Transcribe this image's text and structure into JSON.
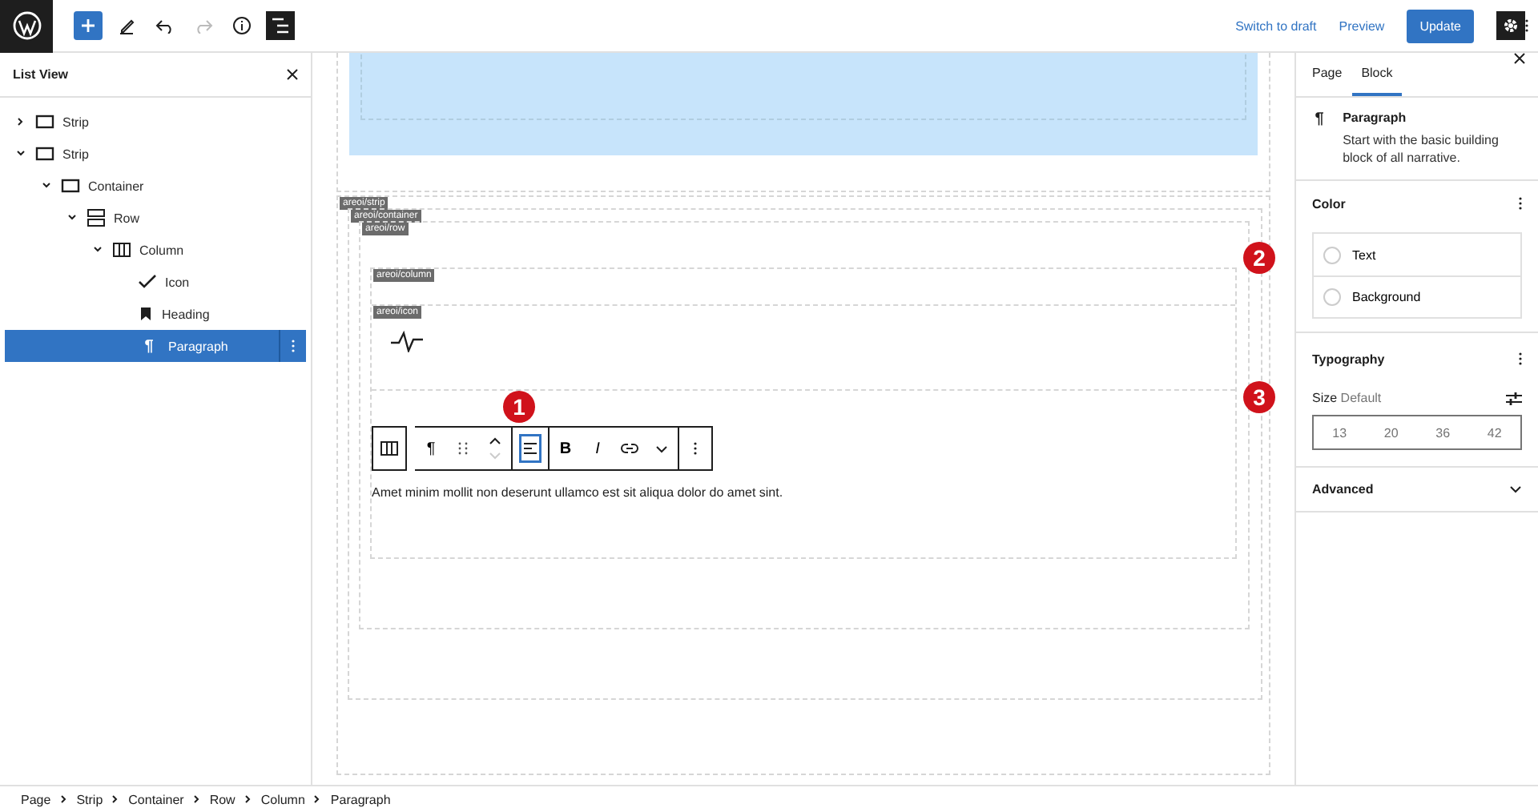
{
  "topbar": {
    "tools": [
      {
        "kind": "add",
        "selected": true
      },
      {
        "kind": "pen",
        "selected": false
      },
      {
        "kind": "undo",
        "selected": false
      },
      {
        "kind": "redo",
        "selected": false
      },
      {
        "kind": "info",
        "selected": false
      },
      {
        "kind": "listview",
        "selected": true
      }
    ],
    "actions": [
      {
        "kind": "link",
        "label": "Switch to draft"
      },
      {
        "kind": "link",
        "label": "Preview"
      },
      {
        "kind": "primary",
        "label": "Update"
      }
    ]
  },
  "list_view": {
    "title": "List View",
    "items": [
      {
        "label": "Strip",
        "kind": "rect",
        "expanded": false,
        "selected": false
      },
      {
        "label": "Strip",
        "kind": "rect",
        "expanded": true,
        "selected": false,
        "children": [
          {
            "label": "Container",
            "kind": "rect",
            "expanded": true,
            "selected": false,
            "children": [
              {
                "label": "Row",
                "kind": "row",
                "expanded": true,
                "selected": false,
                "children": [
                  {
                    "label": "Column",
                    "kind": "column",
                    "expanded": true,
                    "selected": false,
                    "children": [
                      {
                        "label": "Icon",
                        "kind": "check",
                        "selected": false
                      },
                      {
                        "label": "Heading",
                        "kind": "bookmark",
                        "selected": false
                      },
                      {
                        "label": "Paragraph",
                        "kind": "pilcrow",
                        "glyph": "¶",
                        "selected": true
                      }
                    ]
                  }
                ]
              }
            ]
          }
        ]
      }
    ]
  },
  "canvas": {
    "labels": [
      "areoi/strip",
      "areoi/container",
      "areoi/row",
      "areoi/column",
      "areoi/icon"
    ],
    "toolbar": [
      [
        {
          "kind": "columns",
          "selected": false
        }
      ],
      [
        {
          "kind": "text",
          "label": "¶",
          "selected": false
        },
        {
          "kind": "drag",
          "selected": false
        },
        {
          "kind": "movers",
          "selected": false
        }
      ],
      [
        {
          "kind": "align",
          "selected": true
        }
      ],
      [
        {
          "kind": "bold",
          "label": "B",
          "selected": false
        },
        {
          "kind": "italic",
          "label": "I",
          "selected": false
        },
        {
          "kind": "link",
          "selected": false
        },
        {
          "kind": "chevron",
          "selected": false
        }
      ],
      [
        {
          "kind": "more",
          "selected": false
        }
      ]
    ],
    "paragraph": "Amet minim mollit non deserunt ullamco est sit aliqua dolor do amet sint."
  },
  "callouts": [
    "1",
    "2",
    "3"
  ],
  "sidebar": {
    "tabs": [
      {
        "label": "Page",
        "selected": false
      },
      {
        "label": "Block",
        "selected": true
      }
    ],
    "block": {
      "glyph": "¶",
      "name": "Paragraph",
      "description": "Start with the basic building block of all narrative."
    },
    "color": {
      "title": "Color",
      "items": [
        "Text",
        "Background"
      ]
    },
    "typography": {
      "title": "Typography",
      "size_label": "Size",
      "size_value": "Default",
      "sizes": [
        "13",
        "20",
        "36",
        "42"
      ]
    },
    "advanced": {
      "title": "Advanced",
      "expanded": false
    }
  },
  "breadcrumb": [
    "Page",
    "Strip",
    "Container",
    "Row",
    "Column",
    "Paragraph"
  ]
}
